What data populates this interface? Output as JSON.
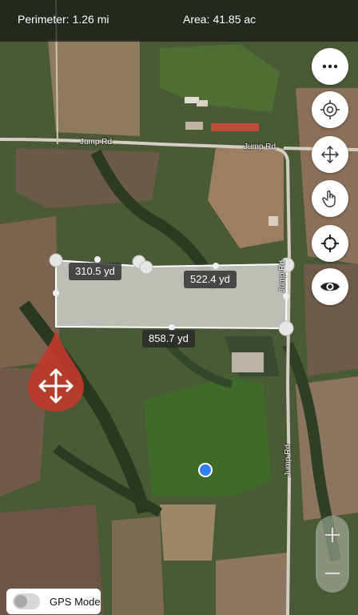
{
  "status": {
    "perimeter_label": "Perimeter:",
    "perimeter_value": "1.26 mi",
    "area_label": "Area:",
    "area_value": "41.85 ac"
  },
  "roads": {
    "top_left": "Jump Rd",
    "top_right": "Jump Rd",
    "vertical_upper": "Jump Rd",
    "vertical_lower": "Jump Rd"
  },
  "measurements": {
    "west_side": "310.5 yd",
    "north_side": "522.4 yd",
    "south_side": "858.7 yd"
  },
  "toolbar": {
    "more": "more-icon",
    "target": "target-icon",
    "move": "move-icon",
    "touch": "hand-icon",
    "locate": "crosshair-icon",
    "view": "eye-icon"
  },
  "zoom": {
    "in": "+",
    "out": "−"
  },
  "gps": {
    "label": "GPS Mode",
    "enabled": false
  },
  "colors": {
    "polygon_fill": "#d9d9d9",
    "polygon_stroke": "#ffffff",
    "move_marker": "#c0392b",
    "location_dot": "#2f80ed"
  }
}
